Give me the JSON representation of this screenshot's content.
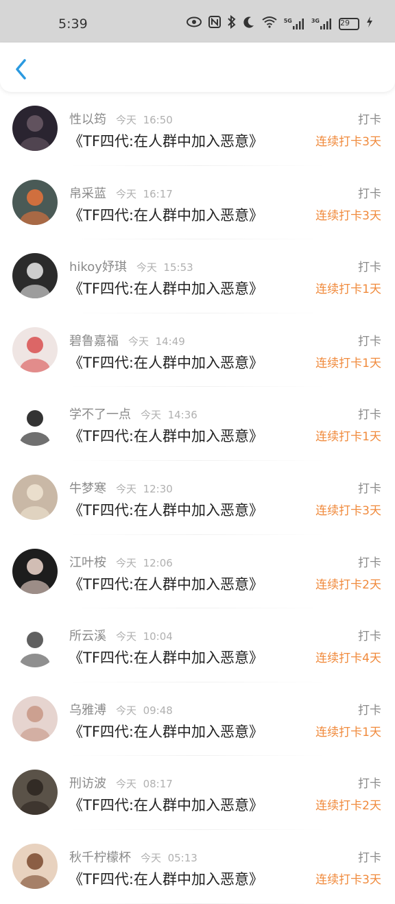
{
  "status": {
    "time": "5:39",
    "battery": "29",
    "net1": "5G",
    "net2": "3G"
  },
  "nav": {
    "back_icon": "chevron-left-icon"
  },
  "records": [
    {
      "user": "性以筠",
      "date": "今天",
      "time": "16:50",
      "title": "《TF四代:在人群中加入恶意》",
      "type": "打卡",
      "streak": "连续打卡3天",
      "avatar": {
        "bg": "#2a2430",
        "fg": "#6b5a66"
      }
    },
    {
      "user": "帛采蓝",
      "date": "今天",
      "time": "16:17",
      "title": "《TF四代:在人群中加入恶意》",
      "type": "打卡",
      "streak": "连续打卡3天",
      "avatar": {
        "bg": "#4a5a56",
        "fg": "#e8733a"
      }
    },
    {
      "user": "hikoy妤琪",
      "date": "今天",
      "time": "15:53",
      "title": "《TF四代:在人群中加入恶意》",
      "type": "打卡",
      "streak": "连续打卡1天",
      "avatar": {
        "bg": "#2b2b2b",
        "fg": "#eaeaea"
      }
    },
    {
      "user": "碧鲁嘉福",
      "date": "今天",
      "time": "14:49",
      "title": "《TF四代:在人群中加入恶意》",
      "type": "打卡",
      "streak": "连续打卡1天",
      "avatar": {
        "bg": "#efe5e3",
        "fg": "#d85050"
      }
    },
    {
      "user": "学不了一点",
      "date": "今天",
      "time": "14:36",
      "title": "《TF四代:在人群中加入恶意》",
      "type": "打卡",
      "streak": "连续打卡1天",
      "avatar": {
        "bg": "#ffffff",
        "fg": "#111111"
      }
    },
    {
      "user": "牛梦寒",
      "date": "今天",
      "time": "12:30",
      "title": "《TF四代:在人群中加入恶意》",
      "type": "打卡",
      "streak": "连续打卡3天",
      "avatar": {
        "bg": "#c9b8a6",
        "fg": "#f0e4d2"
      }
    },
    {
      "user": "江叶桉",
      "date": "今天",
      "time": "12:06",
      "title": "《TF四代:在人群中加入恶意》",
      "type": "打卡",
      "streak": "连续打卡2天",
      "avatar": {
        "bg": "#1d1d1d",
        "fg": "#f1d9cf"
      }
    },
    {
      "user": "所云溪",
      "date": "今天",
      "time": "10:04",
      "title": "《TF四代:在人群中加入恶意》",
      "type": "打卡",
      "streak": "连续打卡4天",
      "avatar": {
        "bg": "#ffffff",
        "fg": "#444444"
      }
    },
    {
      "user": "乌雅溥",
      "date": "今天",
      "time": "09:48",
      "title": "《TF四代:在人群中加入恶意》",
      "type": "打卡",
      "streak": "连续打卡1天",
      "avatar": {
        "bg": "#e6d4cf",
        "fg": "#c79685"
      }
    },
    {
      "user": "刑访波",
      "date": "今天",
      "time": "08:17",
      "title": "《TF四代:在人群中加入恶意》",
      "type": "打卡",
      "streak": "连续打卡2天",
      "avatar": {
        "bg": "#5a5248",
        "fg": "#2c2420"
      }
    },
    {
      "user": "秋千柠檬杯",
      "date": "今天",
      "time": "05:13",
      "title": "《TF四代:在人群中加入恶意》",
      "type": "打卡",
      "streak": "连续打卡3天",
      "avatar": {
        "bg": "#e8d2bf",
        "fg": "#7a4a2e"
      }
    }
  ]
}
